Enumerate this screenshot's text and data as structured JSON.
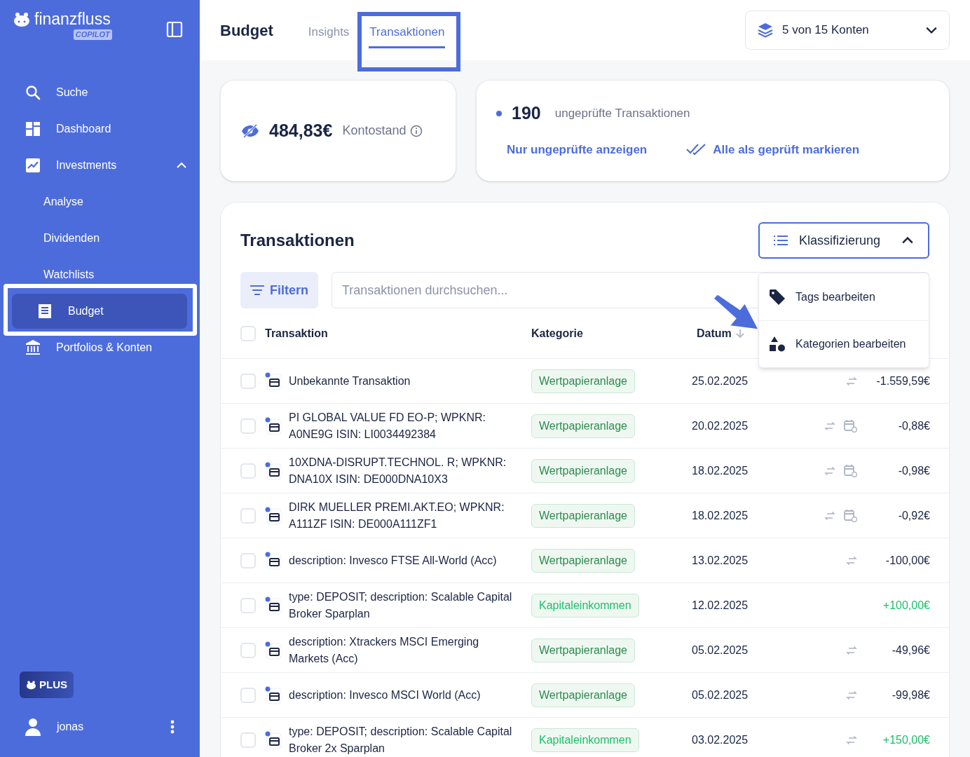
{
  "sidebar": {
    "logo": {
      "name": "finanzfluss",
      "badge": "COPILOT"
    },
    "items": [
      {
        "kind": "search",
        "label": "Suche",
        "selected": false
      },
      {
        "kind": "dashboard",
        "label": "Dashboard",
        "selected": false
      },
      {
        "kind": "investments",
        "label": "Investments",
        "selected": false,
        "expanded": true,
        "children": [
          {
            "label": "Analyse",
            "selected": false
          },
          {
            "label": "Dividenden",
            "selected": false
          },
          {
            "label": "Watchlists",
            "selected": false
          }
        ]
      },
      {
        "kind": "budget",
        "label": "Budget",
        "selected": true,
        "highlighted": true
      },
      {
        "kind": "bank",
        "label": "Portfolios & Konten",
        "selected": false
      }
    ],
    "plan_badge": "PLUS",
    "user": "jonas"
  },
  "header": {
    "title": "Budget",
    "tabs": [
      {
        "label": "Insights",
        "selected": false
      },
      {
        "label": "Transaktionen",
        "selected": true,
        "highlighted": true
      }
    ],
    "account_selector": "5 von 15 Konten"
  },
  "balance_card": {
    "amount": "484,83€",
    "label": "Kontostand"
  },
  "review_card": {
    "count": "190",
    "label": "ungeprüfte Transaktionen",
    "actions": [
      {
        "kind": "filter",
        "label": "Nur ungeprüfte anzeigen"
      },
      {
        "kind": "mark",
        "label": "Alle als geprüft markieren"
      }
    ]
  },
  "transactions": {
    "title": "Transaktionen",
    "classification_button": {
      "label": "Klassifizierung",
      "expanded": true
    },
    "menu": {
      "pointer_arrow": true,
      "items": [
        {
          "kind": "tag",
          "label": "Tags bearbeiten"
        },
        {
          "kind": "shapes",
          "label": "Kategorien bearbeiten"
        }
      ]
    },
    "filter_button": "Filtern",
    "search": {
      "placeholder": "Transaktionen durchsuchen..."
    },
    "columns": [
      "Transaktion",
      "Kategorie",
      "Datum"
    ],
    "all_selected": false,
    "rows": [
      {
        "description": "Unbekannte Transaktion",
        "category": "Wertpapieranlage",
        "color": "#2f8a4f",
        "date": "25.02.2025",
        "transfer": true,
        "recurring": false,
        "amount": "-1.559,59€",
        "positive": false,
        "checked": false
      },
      {
        "description": "PI GLOBAL VALUE FD EO-P; WPKNR: A0NE9G ISIN: LI0034492384",
        "category": "Wertpapieranlage",
        "color": "#2f8a4f",
        "date": "20.02.2025",
        "transfer": true,
        "recurring": true,
        "amount": "-0,88€",
        "positive": false,
        "checked": false
      },
      {
        "description": "10XDNA-DISRUPT.TECHNOL. R; WPKNR: DNA10X ISIN: DE000DNA10X3",
        "category": "Wertpapieranlage",
        "color": "#2f8a4f",
        "date": "18.02.2025",
        "transfer": true,
        "recurring": true,
        "amount": "-0,98€",
        "positive": false,
        "checked": false
      },
      {
        "description": "DIRK MUELLER PREMI.AKT.EO; WPKNR: A111ZF ISIN: DE000A111ZF1",
        "category": "Wertpapieranlage",
        "color": "#2f8a4f",
        "date": "18.02.2025",
        "transfer": true,
        "recurring": true,
        "amount": "-0,92€",
        "positive": false,
        "checked": false
      },
      {
        "description": "description: Invesco FTSE All-World (Acc)",
        "category": "Wertpapieranlage",
        "color": "#2f8a4f",
        "date": "13.02.2025",
        "transfer": true,
        "recurring": false,
        "amount": "-100,00€",
        "positive": false,
        "checked": false
      },
      {
        "description": "type: DEPOSIT; description: Scalable Capital Broker Sparplan",
        "category": "Kapitaleinkommen",
        "color": "#1dbf6a",
        "date": "12.02.2025",
        "transfer": false,
        "recurring": false,
        "amount": "+100,00€",
        "positive": true,
        "checked": false
      },
      {
        "description": "description: Xtrackers MSCI Emerging Markets (Acc)",
        "category": "Wertpapieranlage",
        "color": "#2f8a4f",
        "date": "05.02.2025",
        "transfer": true,
        "recurring": false,
        "amount": "-49,96€",
        "positive": false,
        "checked": false
      },
      {
        "description": "description: Invesco MSCI World (Acc)",
        "category": "Wertpapieranlage",
        "color": "#2f8a4f",
        "date": "05.02.2025",
        "transfer": true,
        "recurring": false,
        "amount": "-99,98€",
        "positive": false,
        "checked": false
      },
      {
        "description": "type: DEPOSIT; description: Scalable Capital Broker 2x Sparplan",
        "category": "Kapitaleinkommen",
        "color": "#1dbf6a",
        "date": "03.02.2025",
        "transfer": true,
        "recurring": false,
        "amount": "+150,00€",
        "positive": true,
        "checked": false
      }
    ]
  }
}
